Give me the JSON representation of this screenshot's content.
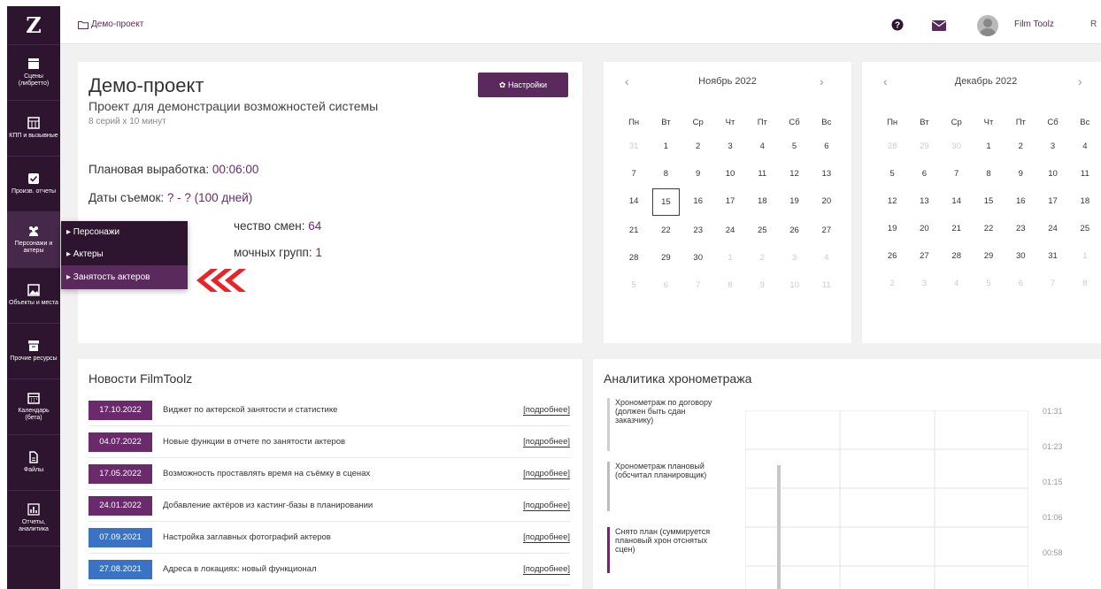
{
  "app": {
    "logo": "Z"
  },
  "sidebar": {
    "items": [
      {
        "label": "Сцены (либретто)",
        "icon": "clapper-icon"
      },
      {
        "label": "КПП и вызывные",
        "icon": "calendar-grid-icon"
      },
      {
        "label": "Произв. отчеты",
        "icon": "check-square-icon"
      },
      {
        "label": "Персонажи и актеры",
        "icon": "people-icon"
      },
      {
        "label": "Объекты и места",
        "icon": "image-icon"
      },
      {
        "label": "Прочие ресурсы",
        "icon": "archive-icon"
      },
      {
        "label": "Календарь (бета)",
        "icon": "calendar-icon"
      },
      {
        "label": "Файлы",
        "icon": "file-icon"
      },
      {
        "label": "Отчеты, аналитика",
        "icon": "bar-chart-icon"
      }
    ]
  },
  "header": {
    "breadcrumb": "Демо-проект",
    "user_name": "Film Toolz",
    "lang": "R"
  },
  "project": {
    "title": "Демо-проект",
    "subtitle": "Проект для демонстрации возможностей системы",
    "meta": "8 серий х 10 минут",
    "settings_label": "✿ Настройки",
    "plan_label": "Плановая выработка: ",
    "plan_value": "00:06:00",
    "dates_label": "Даты съемок: ",
    "dates_value": "? - ? (100 дней)",
    "shifts_label": "чество смен: ",
    "shifts_value": "64",
    "groups_label": "мочных групп: ",
    "groups_value": "1"
  },
  "dropdown": {
    "items": [
      "▸ Персонажи",
      "▸ Актеры",
      "▸ Занятость актеров"
    ]
  },
  "calendars": [
    {
      "month": "Ноябрь 2022",
      "weekdays": [
        "Пн",
        "Вт",
        "Ср",
        "Чт",
        "Пт",
        "Сб",
        "Вс"
      ],
      "days": [
        "31",
        "1",
        "2",
        "3",
        "4",
        "5",
        "6",
        "7",
        "8",
        "9",
        "10",
        "11",
        "12",
        "13",
        "14",
        "15",
        "16",
        "17",
        "18",
        "19",
        "20",
        "21",
        "22",
        "23",
        "24",
        "25",
        "26",
        "27",
        "28",
        "29",
        "30",
        "1",
        "2",
        "3",
        "4",
        "5",
        "6",
        "7",
        "8",
        "9",
        "10",
        "11"
      ],
      "muted": [
        0,
        31,
        32,
        33,
        34,
        35,
        36,
        37,
        38,
        39,
        40,
        41
      ],
      "today": 15
    },
    {
      "month": "Декабрь 2022",
      "weekdays": [
        "Пн",
        "Вт",
        "Ср",
        "Чт",
        "Пт",
        "Сб",
        "Вс"
      ],
      "days": [
        "28",
        "29",
        "30",
        "1",
        "2",
        "3",
        "4",
        "5",
        "6",
        "7",
        "8",
        "9",
        "10",
        "11",
        "12",
        "13",
        "14",
        "15",
        "16",
        "17",
        "18",
        "19",
        "20",
        "21",
        "22",
        "23",
        "24",
        "25",
        "26",
        "27",
        "28",
        "29",
        "30",
        "31",
        "1",
        "2",
        "3",
        "4",
        "5",
        "6",
        "7",
        "8"
      ],
      "muted": [
        0,
        1,
        2,
        34,
        35,
        36,
        37,
        38,
        39,
        40,
        41
      ],
      "today": -1
    }
  ],
  "news": {
    "title": "Новости FilmToolz",
    "more_label": "[подробнее]",
    "items": [
      {
        "date": "17.10.2022",
        "text": "Виджет по актерской занятости и статистике",
        "color": "#6a2a6c"
      },
      {
        "date": "04.07.2022",
        "text": "Новые функции в отчете по занятости актеров",
        "color": "#6a2a6c"
      },
      {
        "date": "17.05.2022",
        "text": "Возможность проставлять время на съёмку в сценах",
        "color": "#6a2a6c"
      },
      {
        "date": "24.01.2022",
        "text": "Добавление актёров из кастинг-базы в планировании",
        "color": "#6a2a6c"
      },
      {
        "date": "07.09.2021",
        "text": "Настройка заглавных фотографий актеров",
        "color": "#3a73c4"
      },
      {
        "date": "27.08.2021",
        "text": "Адреса в локациях: новый функционал",
        "color": "#3a73c4"
      }
    ]
  },
  "analytics": {
    "title": "Аналитика хронометража",
    "legend": [
      {
        "label": "Хронометраж по договору (должен быть сдан заказчику)",
        "color": "#cfcfcf"
      },
      {
        "label": "Хронометраж плановый (обсчитал планировщик)",
        "color": "#bdbdbd"
      },
      {
        "label": "Снято план (суммируется плановый хрон отснятых сцен)",
        "color": "#6a2a6c"
      }
    ],
    "ticks": [
      "01:31",
      "01:23",
      "01:15",
      "01:06",
      "00:58"
    ]
  }
}
